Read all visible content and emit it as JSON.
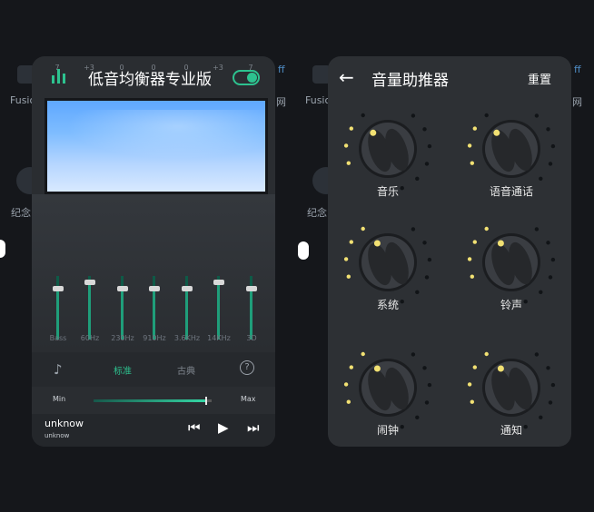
{
  "background": {
    "left_labels": [
      "Fusio",
      "纪念"
    ],
    "right_labels": [
      "Fusio",
      "纪念"
    ],
    "fragments": [
      "网",
      "网",
      "ff",
      "ff"
    ]
  },
  "equalizer": {
    "title": "低音均衡器专业版",
    "enabled": true,
    "gains": [
      "7",
      "+3",
      "0",
      "0",
      "0",
      "+3",
      "7"
    ],
    "bands": [
      {
        "label": "Bass",
        "level": 0.8
      },
      {
        "label": "60Hz",
        "level": 0.9
      },
      {
        "label": "230Hz",
        "level": 0.8
      },
      {
        "label": "910Hz",
        "level": 0.8
      },
      {
        "label": "3.6KHz",
        "level": 0.8
      },
      {
        "label": "14KHz",
        "level": 0.9
      },
      {
        "label": "3D",
        "level": 0.8
      }
    ],
    "presets": {
      "active": "标准",
      "other": "古典",
      "help": "?"
    },
    "range": {
      "min_label": "Min",
      "max_label": "Max",
      "value": 0.95
    },
    "player": {
      "song": "unknow",
      "artist": "unknow"
    },
    "accent_color": "#2dc28f"
  },
  "volume": {
    "title": "音量助推器",
    "reset_label": "重置",
    "knobs": [
      {
        "label": "音乐",
        "level": 0.25
      },
      {
        "label": "语音通话",
        "level": 0.25
      },
      {
        "label": "系统",
        "level": 0.3
      },
      {
        "label": "铃声",
        "level": 0.3
      },
      {
        "label": "闹钟",
        "level": 0.3
      },
      {
        "label": "通知",
        "level": 0.3
      }
    ],
    "lit_dot_color": "#f2e173",
    "dim_dot_color": "#111417"
  }
}
